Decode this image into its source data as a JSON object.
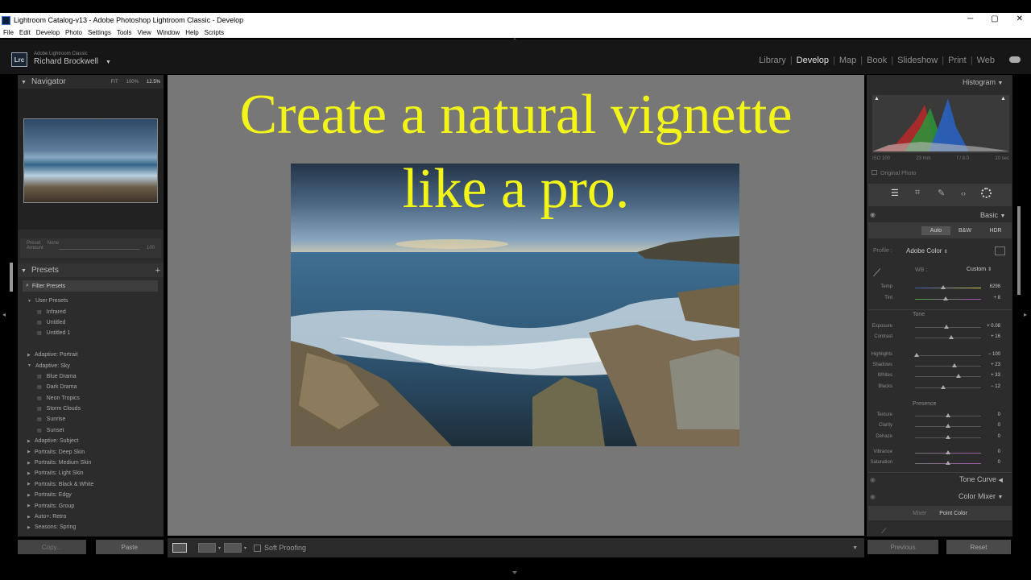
{
  "window": {
    "title": "Lightroom Catalog-v13 - Adobe Photoshop Lightroom Classic - Develop",
    "controls": [
      "─",
      "▢",
      "✕"
    ]
  },
  "menu": [
    "File",
    "Edit",
    "Develop",
    "Photo",
    "Settings",
    "Tools",
    "View",
    "Window",
    "Help",
    "Scripts"
  ],
  "identity": {
    "logo": "Lrc",
    "product": "Adobe Lightroom Classic",
    "user": "Richard Brockwell"
  },
  "modules": [
    "Library",
    "Develop",
    "Map",
    "Book",
    "Slideshow",
    "Print",
    "Web"
  ],
  "active_module": "Develop",
  "navigator": {
    "title": "Navigator",
    "zoom": [
      "FIT",
      "100%",
      "12.5%"
    ]
  },
  "preset_amount": {
    "preset_label": "Preset",
    "preset_value": "None",
    "amount_label": "Amount",
    "amount_value": "100"
  },
  "presets": {
    "title": "Presets",
    "filter": "Filter Presets",
    "items": [
      {
        "label": "User Presets",
        "type": "group-open"
      },
      {
        "label": "Infrared",
        "type": "item"
      },
      {
        "label": "Untitled",
        "type": "item"
      },
      {
        "label": "Untitled 1",
        "type": "item"
      },
      {
        "label": "",
        "type": "gap"
      },
      {
        "label": "Adaptive: Portrait",
        "type": "group"
      },
      {
        "label": "Adaptive: Sky",
        "type": "group-open"
      },
      {
        "label": "Blue Drama",
        "type": "item"
      },
      {
        "label": "Dark Drama",
        "type": "item"
      },
      {
        "label": "Neon Tropics",
        "type": "item"
      },
      {
        "label": "Storm Clouds",
        "type": "item"
      },
      {
        "label": "Sunrise",
        "type": "item"
      },
      {
        "label": "Sunset",
        "type": "item"
      },
      {
        "label": "Adaptive: Subject",
        "type": "group"
      },
      {
        "label": "Portraits: Deep Skin",
        "type": "group"
      },
      {
        "label": "Portraits: Medium Skin",
        "type": "group"
      },
      {
        "label": "Portraits: Light Skin",
        "type": "group"
      },
      {
        "label": "Portraits: Black & White",
        "type": "group"
      },
      {
        "label": "Portraits: Edgy",
        "type": "group"
      },
      {
        "label": "Portraits: Group",
        "type": "group"
      },
      {
        "label": "Auto+: Retro",
        "type": "group"
      },
      {
        "label": "Seasons: Spring",
        "type": "group"
      }
    ]
  },
  "left_buttons": {
    "copy": "Copy...",
    "paste": "Paste"
  },
  "overlay": {
    "line1": "Create a natural vignette",
    "line2": "like a pro."
  },
  "toolbar": {
    "soft_proofing": "Soft Proofing"
  },
  "histogram": {
    "title": "Histogram",
    "iso": "ISO 100",
    "focal": "23 mm",
    "aperture": "f / 8.0",
    "shutter": "10 sec",
    "original": "Original Photo"
  },
  "basic": {
    "title": "Basic",
    "treatments": [
      "Auto",
      "B&W",
      "HDR"
    ],
    "profile_label": "Profile :",
    "profile_value": "Adobe Color",
    "wb_label": "WB :",
    "wb_value": "Custom",
    "tone_label": "Tone",
    "presence_label": "Presence",
    "sliders": [
      {
        "label": "Temp",
        "value": "6298",
        "pos": 0.43
      },
      {
        "label": "Tint",
        "value": "+ 8",
        "pos": 0.46
      },
      {
        "label": "Exposure",
        "value": "+ 0.08",
        "pos": 0.48
      },
      {
        "label": "Contrast",
        "value": "+ 16",
        "pos": 0.55
      },
      {
        "label": "Highlights",
        "value": "− 100",
        "pos": 0.02
      },
      {
        "label": "Shadows",
        "value": "+ 23",
        "pos": 0.6
      },
      {
        "label": "Whites",
        "value": "+ 33",
        "pos": 0.66
      },
      {
        "label": "Blacks",
        "value": "− 12",
        "pos": 0.43
      },
      {
        "label": "Texture",
        "value": "0",
        "pos": 0.5
      },
      {
        "label": "Clarity",
        "value": "0",
        "pos": 0.5
      },
      {
        "label": "Dehaze",
        "value": "0",
        "pos": 0.5
      },
      {
        "label": "Vibrance",
        "value": "0",
        "pos": 0.5
      },
      {
        "label": "Saturation",
        "value": "0",
        "pos": 0.5
      }
    ]
  },
  "sections": {
    "tone_curve": "Tone Curve",
    "color_mixer": "Color Mixer",
    "mixer_tabs": [
      "Mixer",
      "Point Color"
    ]
  },
  "right_buttons": {
    "previous": "Previous",
    "reset": "Reset"
  }
}
